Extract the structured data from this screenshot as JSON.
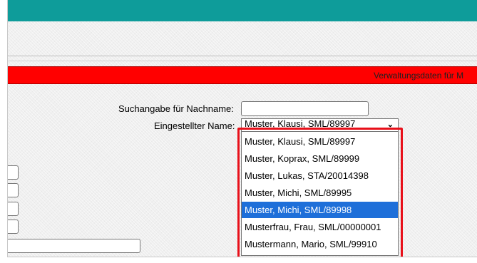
{
  "header": {
    "section_title": "Verwaltungsdaten für M"
  },
  "form": {
    "search_label": "Suchangabe für Nachname:",
    "search_value": "",
    "name_label": "Eingestellter Name:",
    "name_selected": "Muster, Klausi, SML/89997",
    "caret": "⌄"
  },
  "dropdown": {
    "options": [
      {
        "label": "Muster, Klausi, SML/89997",
        "selected": false
      },
      {
        "label": "Muster, Koprax, SML/89999",
        "selected": false
      },
      {
        "label": "Muster, Lukas, STA/20014398",
        "selected": false
      },
      {
        "label": "Muster, Michi, SML/89995",
        "selected": false
      },
      {
        "label": "Muster, Michi, SML/89998",
        "selected": true
      },
      {
        "label": "Musterfrau, Frau, SML/00000001",
        "selected": false
      },
      {
        "label": "Mustermann, Mario, SML/99910",
        "selected": false
      }
    ]
  },
  "colors": {
    "top_bar": "#0e9c9a",
    "section_bar": "#ff0000",
    "highlight_box": "#e8101a",
    "selected_option": "#1e6fd9"
  }
}
